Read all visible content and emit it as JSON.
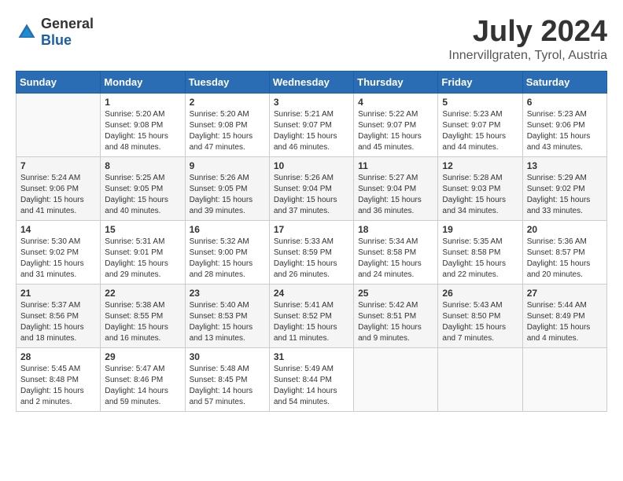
{
  "header": {
    "logo_general": "General",
    "logo_blue": "Blue",
    "month": "July 2024",
    "location": "Innervillgraten, Tyrol, Austria"
  },
  "days_of_week": [
    "Sunday",
    "Monday",
    "Tuesday",
    "Wednesday",
    "Thursday",
    "Friday",
    "Saturday"
  ],
  "weeks": [
    [
      {
        "day": "",
        "info": ""
      },
      {
        "day": "1",
        "info": "Sunrise: 5:20 AM\nSunset: 9:08 PM\nDaylight: 15 hours\nand 48 minutes."
      },
      {
        "day": "2",
        "info": "Sunrise: 5:20 AM\nSunset: 9:08 PM\nDaylight: 15 hours\nand 47 minutes."
      },
      {
        "day": "3",
        "info": "Sunrise: 5:21 AM\nSunset: 9:07 PM\nDaylight: 15 hours\nand 46 minutes."
      },
      {
        "day": "4",
        "info": "Sunrise: 5:22 AM\nSunset: 9:07 PM\nDaylight: 15 hours\nand 45 minutes."
      },
      {
        "day": "5",
        "info": "Sunrise: 5:23 AM\nSunset: 9:07 PM\nDaylight: 15 hours\nand 44 minutes."
      },
      {
        "day": "6",
        "info": "Sunrise: 5:23 AM\nSunset: 9:06 PM\nDaylight: 15 hours\nand 43 minutes."
      }
    ],
    [
      {
        "day": "7",
        "info": "Sunrise: 5:24 AM\nSunset: 9:06 PM\nDaylight: 15 hours\nand 41 minutes."
      },
      {
        "day": "8",
        "info": "Sunrise: 5:25 AM\nSunset: 9:05 PM\nDaylight: 15 hours\nand 40 minutes."
      },
      {
        "day": "9",
        "info": "Sunrise: 5:26 AM\nSunset: 9:05 PM\nDaylight: 15 hours\nand 39 minutes."
      },
      {
        "day": "10",
        "info": "Sunrise: 5:26 AM\nSunset: 9:04 PM\nDaylight: 15 hours\nand 37 minutes."
      },
      {
        "day": "11",
        "info": "Sunrise: 5:27 AM\nSunset: 9:04 PM\nDaylight: 15 hours\nand 36 minutes."
      },
      {
        "day": "12",
        "info": "Sunrise: 5:28 AM\nSunset: 9:03 PM\nDaylight: 15 hours\nand 34 minutes."
      },
      {
        "day": "13",
        "info": "Sunrise: 5:29 AM\nSunset: 9:02 PM\nDaylight: 15 hours\nand 33 minutes."
      }
    ],
    [
      {
        "day": "14",
        "info": "Sunrise: 5:30 AM\nSunset: 9:02 PM\nDaylight: 15 hours\nand 31 minutes."
      },
      {
        "day": "15",
        "info": "Sunrise: 5:31 AM\nSunset: 9:01 PM\nDaylight: 15 hours\nand 29 minutes."
      },
      {
        "day": "16",
        "info": "Sunrise: 5:32 AM\nSunset: 9:00 PM\nDaylight: 15 hours\nand 28 minutes."
      },
      {
        "day": "17",
        "info": "Sunrise: 5:33 AM\nSunset: 8:59 PM\nDaylight: 15 hours\nand 26 minutes."
      },
      {
        "day": "18",
        "info": "Sunrise: 5:34 AM\nSunset: 8:58 PM\nDaylight: 15 hours\nand 24 minutes."
      },
      {
        "day": "19",
        "info": "Sunrise: 5:35 AM\nSunset: 8:58 PM\nDaylight: 15 hours\nand 22 minutes."
      },
      {
        "day": "20",
        "info": "Sunrise: 5:36 AM\nSunset: 8:57 PM\nDaylight: 15 hours\nand 20 minutes."
      }
    ],
    [
      {
        "day": "21",
        "info": "Sunrise: 5:37 AM\nSunset: 8:56 PM\nDaylight: 15 hours\nand 18 minutes."
      },
      {
        "day": "22",
        "info": "Sunrise: 5:38 AM\nSunset: 8:55 PM\nDaylight: 15 hours\nand 16 minutes."
      },
      {
        "day": "23",
        "info": "Sunrise: 5:40 AM\nSunset: 8:53 PM\nDaylight: 15 hours\nand 13 minutes."
      },
      {
        "day": "24",
        "info": "Sunrise: 5:41 AM\nSunset: 8:52 PM\nDaylight: 15 hours\nand 11 minutes."
      },
      {
        "day": "25",
        "info": "Sunrise: 5:42 AM\nSunset: 8:51 PM\nDaylight: 15 hours\nand 9 minutes."
      },
      {
        "day": "26",
        "info": "Sunrise: 5:43 AM\nSunset: 8:50 PM\nDaylight: 15 hours\nand 7 minutes."
      },
      {
        "day": "27",
        "info": "Sunrise: 5:44 AM\nSunset: 8:49 PM\nDaylight: 15 hours\nand 4 minutes."
      }
    ],
    [
      {
        "day": "28",
        "info": "Sunrise: 5:45 AM\nSunset: 8:48 PM\nDaylight: 15 hours\nand 2 minutes."
      },
      {
        "day": "29",
        "info": "Sunrise: 5:47 AM\nSunset: 8:46 PM\nDaylight: 14 hours\nand 59 minutes."
      },
      {
        "day": "30",
        "info": "Sunrise: 5:48 AM\nSunset: 8:45 PM\nDaylight: 14 hours\nand 57 minutes."
      },
      {
        "day": "31",
        "info": "Sunrise: 5:49 AM\nSunset: 8:44 PM\nDaylight: 14 hours\nand 54 minutes."
      },
      {
        "day": "",
        "info": ""
      },
      {
        "day": "",
        "info": ""
      },
      {
        "day": "",
        "info": ""
      }
    ]
  ]
}
